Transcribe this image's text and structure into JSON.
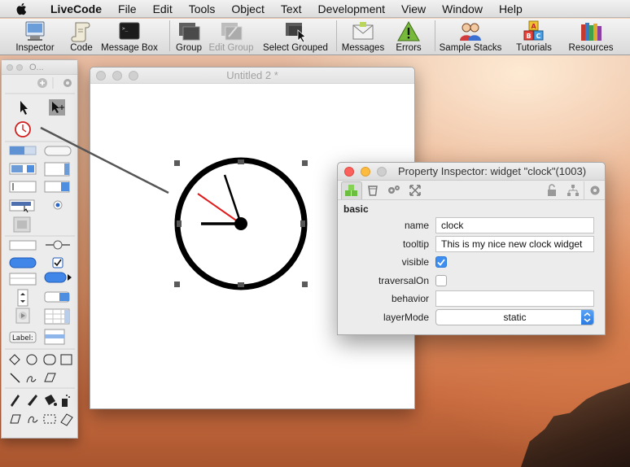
{
  "menubar": {
    "app_name": "LiveCode",
    "items": [
      "File",
      "Edit",
      "Tools",
      "Object",
      "Text",
      "Development",
      "View",
      "Window",
      "Help"
    ]
  },
  "toolbar": {
    "buttons": [
      {
        "label": "Inspector",
        "icon": "inspector-icon"
      },
      {
        "label": "Code",
        "icon": "code-scroll-icon"
      },
      {
        "label": "Message Box",
        "icon": "terminal-icon"
      },
      {
        "label": "Group",
        "icon": "group-icon"
      },
      {
        "label": "Edit Group",
        "icon": "edit-group-icon",
        "disabled": true
      },
      {
        "label": "Select Grouped",
        "icon": "select-grouped-icon"
      },
      {
        "label": "Messages",
        "icon": "envelope-icon"
      },
      {
        "label": "Errors",
        "icon": "warning-icon"
      },
      {
        "label": "Sample Stacks",
        "icon": "people-icon"
      },
      {
        "label": "Tutorials",
        "icon": "abc-blocks-icon"
      },
      {
        "label": "Resources",
        "icon": "books-icon"
      }
    ]
  },
  "palette": {
    "title": "O..."
  },
  "stack_window": {
    "title": "Untitled 2 *"
  },
  "inspector": {
    "title": "Property Inspector: widget \"clock\"(1003)",
    "section": "basic",
    "fields": {
      "name_label": "name",
      "name_value": "clock",
      "tooltip_label": "tooltip",
      "tooltip_value": "This is my nice new clock widget",
      "visible_label": "visible",
      "visible_checked": true,
      "traversal_label": "traversalOn",
      "traversal_checked": false,
      "behavior_label": "behavior",
      "behavior_value": "",
      "layermode_label": "layerMode",
      "layermode_value": "static"
    }
  },
  "colors": {
    "clock_second_hand": "#e01b1b",
    "checkbox_accent": "#3d8ef0"
  }
}
